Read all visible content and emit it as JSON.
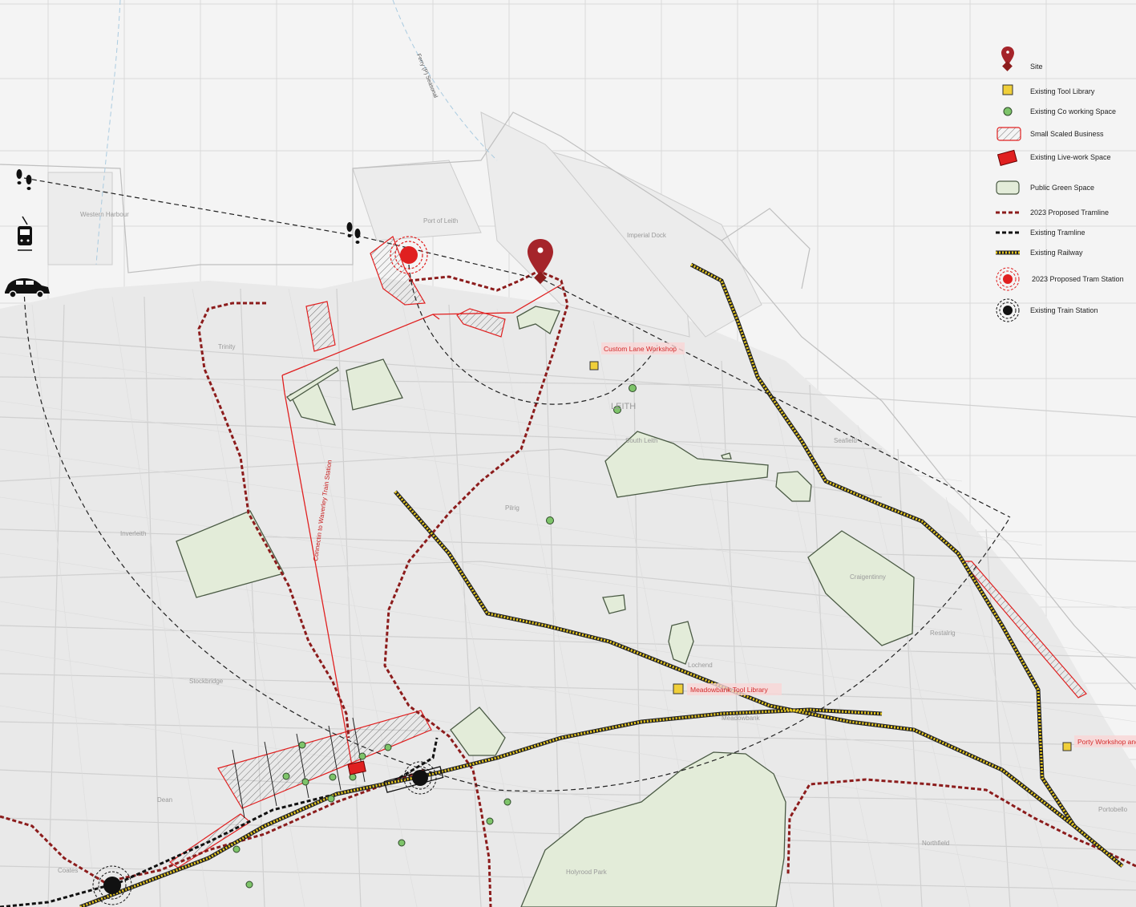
{
  "legend": {
    "site": "Site",
    "tool_library": "Existing Tool Library",
    "coworking": "Existing Co working Space",
    "small_business": "Small Scaled Business",
    "live_work": "Existing Live-work Space",
    "green_space": "Public Green Space",
    "proposed_tramline": "2023 Proposed Tramline",
    "existing_tramline": "Existing Tramline",
    "railway": "Existing Railway",
    "proposed_tram_station": "2023 Proposed Tram Station",
    "train_station": "Existing Train Station"
  },
  "labels": {
    "custom_lane": "Custom Lane Workshop",
    "meadowbank": "Meadowbank Tool Library",
    "porty": "Porty Workshop and",
    "waverley_connection": "Connectin to Waverley Train Station",
    "ferry": "Ferry  (P) Seasonal"
  },
  "place_names": {
    "port_of_leith": "Port of Leith",
    "leith": "LEITH",
    "south_leith": "South Leith",
    "trinity": "Trinity",
    "inverleith": "Inverleith",
    "craigentinny": "Craigentinny",
    "lochend": "Lochend",
    "holyrood_park": "Holyrood Park",
    "dean": "Dean",
    "coates": "Coates",
    "restalrig": "Restalrig",
    "portobello": "Portobello",
    "seafield": "Seafield",
    "stockbridge": "Stockbridge",
    "pilrig": "Pilrig",
    "northfield": "Northfield",
    "meadowbank_area": "Meadowbank",
    "western_harbour": "Western Harbour",
    "imperial_dock": "Imperial Dock"
  },
  "colors": {
    "background": "#f4f4f4",
    "grid": "#d6d6d6",
    "streets": "#cfcfcf",
    "red": "#e02020",
    "dark_red": "#8c1c1c",
    "tram_dashed": "#7a1a1a",
    "green_fill": "#e3ecd9",
    "green_stroke": "#4a5a44",
    "tool_library": "#f0cf3a",
    "coworking": "#7ec46a",
    "railway": "#e8c81e"
  },
  "icons": [
    "footsteps-icon",
    "tram-icon",
    "car-icon",
    "site-pin-icon"
  ]
}
